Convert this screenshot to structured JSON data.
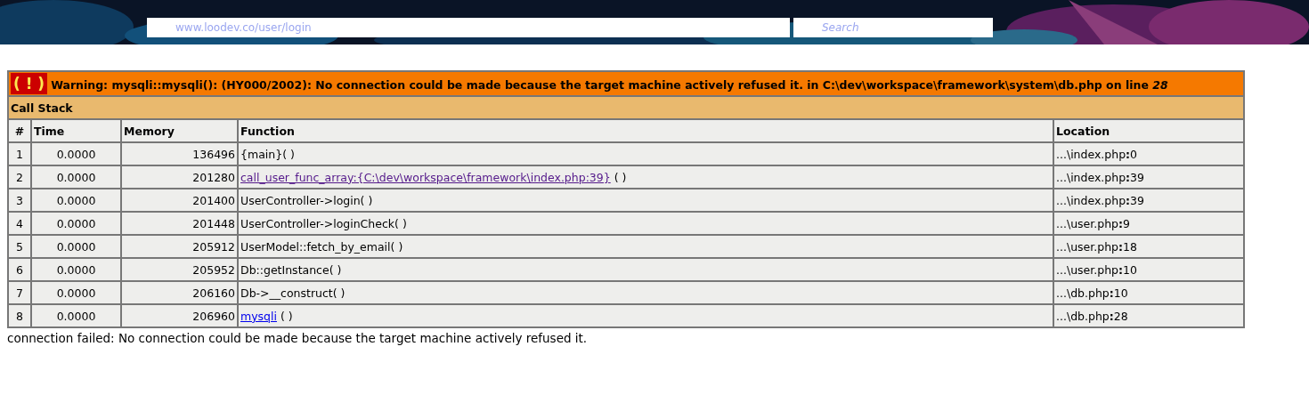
{
  "browser": {
    "url": "www.loodev.co/user/login",
    "search_placeholder": "Search"
  },
  "error": {
    "icon_text": "( ! )",
    "message": "Warning: mysqli::mysqli(): (HY000/2002): No connection could be made because the target machine actively refused it. in C:\\dev\\workspace\\framework\\system\\db.php on line *28*",
    "section_title": "Call Stack",
    "columns": [
      "#",
      "Time",
      "Memory",
      "Function",
      "Location"
    ],
    "rows": [
      {
        "index": "1",
        "time": "0.0000",
        "memory": "136496",
        "function": "{main}( )",
        "location": "...\\index.php**:**0"
      },
      {
        "index": "2",
        "time": "0.0000",
        "memory": "201280",
        "link": "call_user_func_array:{C:\\dev\\workspace\\framework\\index.php:39}",
        "visited": true,
        "function": " ( )",
        "location": "...\\index.php**:**39"
      },
      {
        "index": "3",
        "time": "0.0000",
        "memory": "201400",
        "function": "UserController->login( )",
        "location": "...\\index.php**:**39"
      },
      {
        "index": "4",
        "time": "0.0000",
        "memory": "201448",
        "function": "UserController->loginCheck( )",
        "location": "...\\user.php**:**9"
      },
      {
        "index": "5",
        "time": "0.0000",
        "memory": "205912",
        "function": "UserModel::fetch_by_email( )",
        "location": "...\\user.php**:**18"
      },
      {
        "index": "6",
        "time": "0.0000",
        "memory": "205952",
        "function": "Db::getInstance( )",
        "location": "...\\user.php**:**10"
      },
      {
        "index": "7",
        "time": "0.0000",
        "memory": "206160",
        "function": "Db->__construct( )",
        "location": "...\\db.php**:**10"
      },
      {
        "index": "8",
        "time": "0.0000",
        "memory": "206960",
        "link": "mysqli",
        "visited": false,
        "function": " ( )",
        "location": "...\\db.php**:**28"
      }
    ]
  },
  "message": "connection failed: No connection could be made because the target machine actively refused it."
}
